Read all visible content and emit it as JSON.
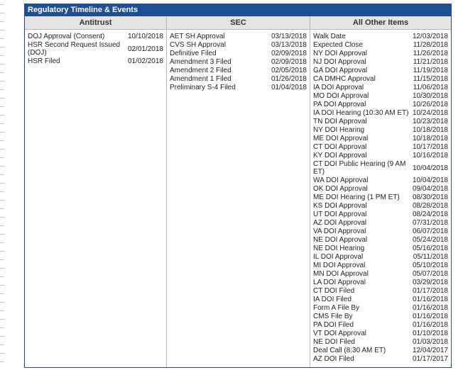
{
  "panel": {
    "title": "Regulatory Timeline & Events"
  },
  "columns": [
    {
      "header": "Antitrust",
      "items": [
        {
          "label": "DOJ Approval (Consent)",
          "date": "10/10/2018"
        },
        {
          "label": "HSR Second Request Issued (DOJ)",
          "date": "02/01/2018"
        },
        {
          "label": "HSR Filed",
          "date": "01/02/2018"
        }
      ]
    },
    {
      "header": "SEC",
      "items": [
        {
          "label": "AET SH Approval",
          "date": "03/13/2018"
        },
        {
          "label": "CVS SH Approval",
          "date": "03/13/2018"
        },
        {
          "label": "Definitive Filed",
          "date": "02/09/2018"
        },
        {
          "label": "Amendment 3 Filed",
          "date": "02/09/2018"
        },
        {
          "label": "Amendment 2 Filed",
          "date": "02/05/2018"
        },
        {
          "label": "Amendment 1 Filed",
          "date": "01/26/2018"
        },
        {
          "label": "Preliminary S-4 Filed",
          "date": "01/04/2018"
        }
      ]
    },
    {
      "header": "All Other Items",
      "items": [
        {
          "label": "Walk Date",
          "date": "12/03/2018"
        },
        {
          "label": "Expected Close",
          "date": "11/28/2018"
        },
        {
          "label": "NY DOI Approval",
          "date": "11/26/2018"
        },
        {
          "label": "NJ DOI Approval",
          "date": "11/21/2018"
        },
        {
          "label": "GA DOI Approval",
          "date": "11/19/2018"
        },
        {
          "label": "CA DMHC Approval",
          "date": "11/15/2018"
        },
        {
          "label": "IA DOI Approval",
          "date": "11/06/2018"
        },
        {
          "label": "MO DOI Approval",
          "date": "10/30/2018"
        },
        {
          "label": "PA DOI Approval",
          "date": "10/26/2018"
        },
        {
          "label": "IA DOI Hearing (10:30 AM ET)",
          "date": "10/24/2018"
        },
        {
          "label": "TN DOI Approval",
          "date": "10/23/2018"
        },
        {
          "label": "NY DOI Hearing",
          "date": "10/18/2018"
        },
        {
          "label": "ME DOI Approval",
          "date": "10/18/2018"
        },
        {
          "label": "CT DOI Approval",
          "date": "10/17/2018"
        },
        {
          "label": "KY DOI Approval",
          "date": "10/16/2018"
        },
        {
          "label": "CT DOI Public Hearing (9 AM ET)",
          "date": "10/04/2018"
        },
        {
          "label": "WA DOI Approval",
          "date": "10/04/2018"
        },
        {
          "label": "OK DOI Approval",
          "date": "09/04/2018"
        },
        {
          "label": "ME DOI Hearing (1 PM ET)",
          "date": "08/30/2018"
        },
        {
          "label": "KS DOI Approval",
          "date": "08/28/2018"
        },
        {
          "label": "UT DOI Approval",
          "date": "08/24/2018"
        },
        {
          "label": "AZ DOI Approval",
          "date": "07/31/2018"
        },
        {
          "label": "VA DOI Approval",
          "date": "06/07/2018"
        },
        {
          "label": "NE DOI Approval",
          "date": "05/24/2018"
        },
        {
          "label": "NE DOI Hearing",
          "date": "05/16/2018"
        },
        {
          "label": "IL DOI Approval",
          "date": "05/11/2018"
        },
        {
          "label": "MI DOI Approval",
          "date": "05/10/2018"
        },
        {
          "label": "MN DOI Approval",
          "date": "05/07/2018"
        },
        {
          "label": "LA DOI Approval",
          "date": "03/29/2018"
        },
        {
          "label": "CT DOI Filed",
          "date": "01/17/2018"
        },
        {
          "label": "IA DOI Filed",
          "date": "01/16/2018"
        },
        {
          "label": "Form A File By",
          "date": "01/16/2018"
        },
        {
          "label": "CMS File By",
          "date": "01/16/2018"
        },
        {
          "label": "PA DOI Filed",
          "date": "01/16/2018"
        },
        {
          "label": "VT DOI Approval",
          "date": "01/10/2018"
        },
        {
          "label": "NE DOI Filed",
          "date": "01/03/2018"
        },
        {
          "label": "Deal Call (8:30 AM ET)",
          "date": "12/04/2017"
        },
        {
          "label": "AZ DOI Filed",
          "date": "01/17/2017"
        }
      ]
    }
  ]
}
